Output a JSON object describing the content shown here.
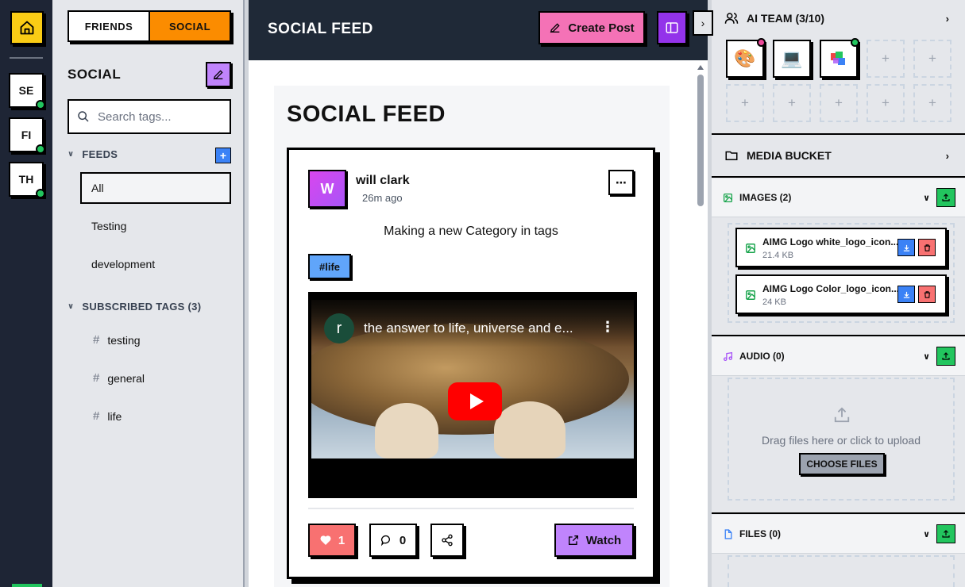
{
  "rail": {
    "items": [
      {
        "label": "SE"
      },
      {
        "label": "FI"
      },
      {
        "label": "TH"
      }
    ]
  },
  "sidebar": {
    "toggle": {
      "friends": "FRIENDS",
      "social": "SOCIAL",
      "active": "SOCIAL"
    },
    "title": "SOCIAL",
    "search_placeholder": "Search tags...",
    "feeds_header": "FEEDS",
    "feeds": [
      {
        "label": "All",
        "active": true
      },
      {
        "label": "Testing"
      },
      {
        "label": "development"
      }
    ],
    "subscribed_header": "SUBSCRIBED TAGS (3)",
    "tags": [
      {
        "label": "testing"
      },
      {
        "label": "general"
      },
      {
        "label": "life"
      }
    ]
  },
  "main": {
    "header_title": "SOCIAL FEED",
    "create_post_label": "Create Post",
    "feed_title": "SOCIAL FEED",
    "post": {
      "avatar_letter": "W",
      "author": "will clark",
      "time": "26m ago",
      "text": "Making a new Category in tags",
      "hashtag": "#life",
      "video": {
        "channel_letter": "r",
        "title": "the answer to life, universe and e..."
      },
      "likes": "1",
      "comments": "0",
      "watch_label": "Watch"
    }
  },
  "right": {
    "ai_team_label": "AI TEAM (3/10)",
    "media_bucket_label": "MEDIA BUCKET",
    "images_label": "IMAGES (2)",
    "images": [
      {
        "name": "AIMG Logo white_logo_icon...",
        "size": "21.4 KB"
      },
      {
        "name": "AIMG Logo Color_logo_icon...",
        "size": "24 KB"
      }
    ],
    "audio_label": "AUDIO (0)",
    "dropzone_hint": "Drag files here or click to upload",
    "choose_files_label": "CHOOSE FILES",
    "files_label": "FILES (0)",
    "team_agents": [
      {
        "icon": "palette-icon",
        "status_color": "#ec4899"
      },
      {
        "icon": "monitor-icon",
        "status_color": ""
      },
      {
        "icon": "blocks-icon",
        "status_color": "#22c55e"
      }
    ]
  },
  "colors": {
    "accent_orange": "#fb8c00",
    "accent_pink": "#f472b6",
    "accent_purple": "#9333ea",
    "accent_green": "#22c55e",
    "accent_yellow": "#facc15"
  }
}
